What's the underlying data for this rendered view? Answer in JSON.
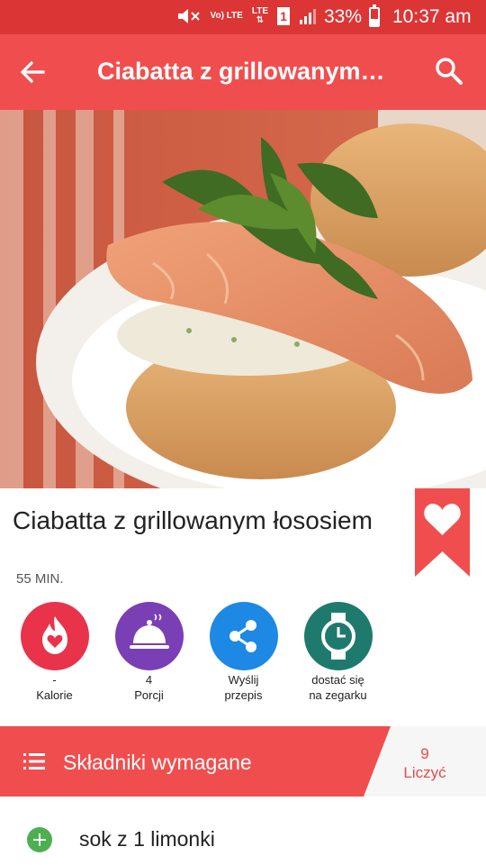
{
  "status_bar": {
    "volte_label": "Vo) LTE",
    "lte_label": "LTE",
    "sim_label": "1",
    "battery": "33%",
    "time": "10:37 am"
  },
  "app_bar": {
    "title": "Ciabatta z grillowanym…",
    "back_icon": "arrow-back-icon",
    "search_icon": "search-icon"
  },
  "recipe": {
    "title": "Ciabatta z grillowanym łososiem",
    "time": "55 MIN.",
    "favorite_icon": "heart-icon"
  },
  "actions": [
    {
      "line1": "-",
      "line2": "Kalorie",
      "color": "#e8334a",
      "icon": "flame-heart-icon"
    },
    {
      "line1": "4",
      "line2": "Porcji",
      "color": "#7b3fb5",
      "icon": "serving-cloche-icon"
    },
    {
      "line1": "Wyślij",
      "line2": "przepis",
      "color": "#1e88e5",
      "icon": "share-icon"
    },
    {
      "line1": "dostać się",
      "line2": "na zegarku",
      "color": "#1f7a6e",
      "icon": "watch-icon"
    }
  ],
  "ingredients": {
    "header": "Składniki wymagane",
    "count_value": "9",
    "count_label": "Liczyć",
    "items": [
      {
        "text": "sok z 1 limonki"
      }
    ]
  },
  "colors": {
    "status_bar": "#dc3535",
    "app_bar": "#f04e4e",
    "accent": "#f04e4e",
    "add_button": "#4caf50"
  }
}
